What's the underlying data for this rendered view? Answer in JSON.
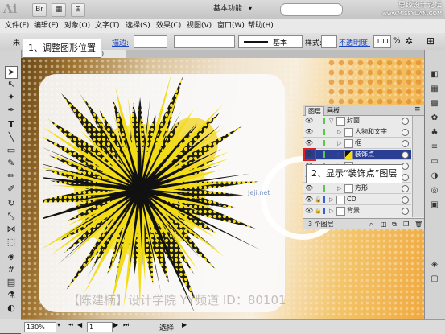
{
  "titlebar": {
    "app_logo": "Ai",
    "workspace": "基本功能",
    "watermark_line1": "思缘设计论坛",
    "watermark_line2": "www.MISSYUAN.COM"
  },
  "menu": {
    "items": [
      "文件(F)",
      "编辑(E)",
      "对象(O)",
      "文字(T)",
      "选择(S)",
      "效果(C)",
      "视图(V)",
      "窗口(W)",
      "帮助(H)"
    ]
  },
  "controlbar": {
    "selection_label": "未",
    "stroke_label": "描边:",
    "stroke_style": "基本",
    "style_label": "样式:",
    "opacity_label": "不透明度:",
    "opacity_value": "100",
    "opacity_unit": "%"
  },
  "document": {
    "tab_label": "览)"
  },
  "canvas": {
    "watermark": "【陈建楠】设计学院  YY频道 ID：80101",
    "small_watermark": "Jeji.net"
  },
  "layers_panel": {
    "tabs": [
      "图层",
      "画板"
    ],
    "rows": [
      {
        "name": "封面",
        "indent": 0,
        "expanded": true,
        "swatch": "#5ac84a",
        "selected": false
      },
      {
        "name": "人物和文字",
        "indent": 1,
        "expanded": false,
        "swatch": "#5ac84a",
        "selected": false
      },
      {
        "name": "框",
        "indent": 1,
        "expanded": false,
        "swatch": "#5ac84a",
        "selected": false
      },
      {
        "name": "装饰点",
        "indent": 1,
        "expanded": false,
        "swatch": "#5ac84a",
        "selected": true
      },
      {
        "name": "",
        "indent": 1,
        "expanded": false,
        "swatch": "#5ac84a",
        "selected": false
      },
      {
        "name": "圆花",
        "indent": 1,
        "expanded": false,
        "swatch": "#5ac84a",
        "selected": false
      },
      {
        "name": "方形",
        "indent": 1,
        "expanded": false,
        "swatch": "#5ac84a",
        "selected": false
      },
      {
        "name": "CD",
        "indent": 0,
        "expanded": false,
        "swatch": "#3a5fd0",
        "selected": false
      },
      {
        "name": "背景",
        "indent": 0,
        "expanded": false,
        "swatch": "#3a5fd0",
        "selected": false
      }
    ],
    "footer": "3 个图层"
  },
  "callouts": {
    "step1": "1、调整图形位置",
    "step2": "2、显示“装饰点”图层"
  },
  "statusbar": {
    "zoom": "130%",
    "page": "1",
    "tool": "选择"
  },
  "colors": {
    "selection_blue": "#2a3f94",
    "highlight_red": "#e02020",
    "burst_yellow": "#f2dc18"
  }
}
